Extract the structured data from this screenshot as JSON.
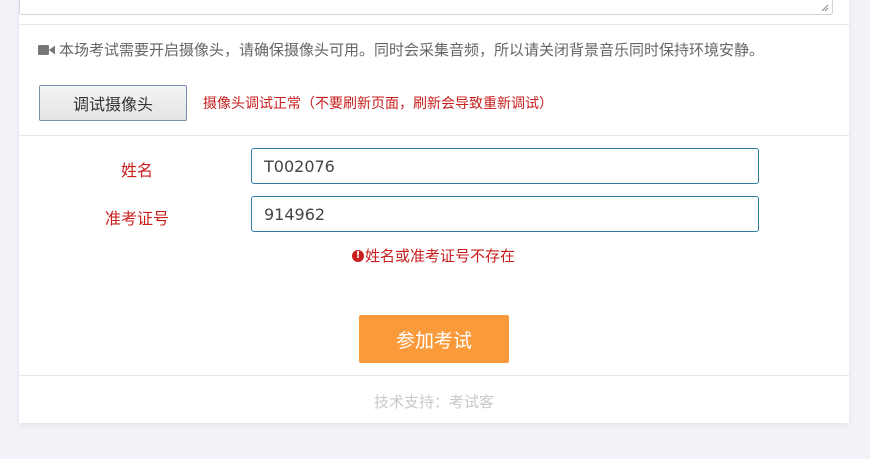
{
  "notice": {
    "icon": "video-camera-icon",
    "text": "本场考试需要开启摄像头，请确保摄像头可用。同时会采集音频，所以请关闭背景音乐同时保持环境安静。"
  },
  "camera": {
    "test_button_label": "调试摄像头",
    "status_text": "摄像头调试正常（不要刷新页面，刷新会导致重新调试）"
  },
  "form": {
    "name_label": "姓名",
    "name_value": "T002076",
    "ticket_label": "准考证号",
    "ticket_value": "914962",
    "error_icon": "exclamation-circle-icon",
    "error_text": "姓名或准考证号不存在"
  },
  "actions": {
    "join_label": "参加考试"
  },
  "footer": {
    "text": "技术支持：考试客"
  },
  "colors": {
    "error_red": "#c81e1e",
    "primary_orange": "#fb9a3a",
    "input_border": "#2f7fa8",
    "page_background": "#f2f2f8"
  }
}
